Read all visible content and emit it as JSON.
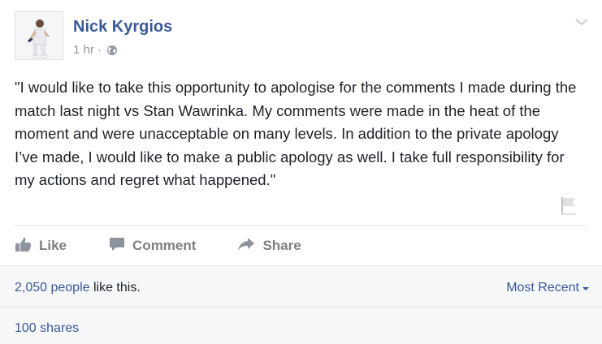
{
  "post": {
    "author": "Nick Kyrgios",
    "time": "1 hr",
    "separator": "·",
    "privacy_icon": "globe-icon",
    "text": "\"I would like to take this opportunity to apologise for the comments I made during the match last night vs Stan Wawrinka. My comments were made in the heat of the moment and were unacceptable on many levels. In addition to the private apology I’ve made, I would like to make a public apology as well. I take full responsibility for my actions and regret what happened.\""
  },
  "actions": {
    "like_label": "Like",
    "comment_label": "Comment",
    "share_label": "Share"
  },
  "footer": {
    "likes_count_link": "2,050 people",
    "likes_suffix": " like this.",
    "sort_label": "Most Recent",
    "shares_label": "100 shares"
  },
  "colors": {
    "link": "#3b5998",
    "action_gray": "#7f7f7f",
    "footer_bg": "#f6f7f9"
  }
}
